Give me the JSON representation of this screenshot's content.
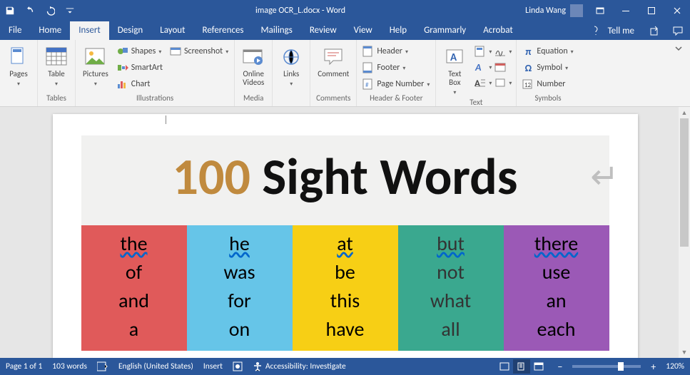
{
  "titlebar": {
    "title": "image OCR_L.docx - Word",
    "user": "Linda Wang"
  },
  "menu": {
    "items": [
      "File",
      "Home",
      "Insert",
      "Design",
      "Layout",
      "References",
      "Mailings",
      "Review",
      "View",
      "Help",
      "Grammarly",
      "Acrobat"
    ],
    "active": "Insert",
    "tellme": "Tell me"
  },
  "ribbon": {
    "pages": "Pages",
    "tables": {
      "btn": "Table",
      "label": "Tables"
    },
    "illustrations": {
      "pictures": "Pictures",
      "shapes": "Shapes",
      "smartart": "SmartArt",
      "chart": "Chart",
      "screenshot": "Screenshot",
      "label": "Illustrations"
    },
    "media": {
      "online": "Online\nVideos",
      "label": "Media"
    },
    "links": {
      "btn": "Links",
      "label": ""
    },
    "comments": {
      "btn": "Comment",
      "label": "Comments"
    },
    "headerfooter": {
      "header": "Header",
      "footer": "Footer",
      "pagenum": "Page Number",
      "label": "Header & Footer"
    },
    "text": {
      "textbox": "Text\nBox",
      "label": "Text"
    },
    "symbols": {
      "equation": "Equation",
      "symbol": "Symbol",
      "number": "Number",
      "label": "Symbols"
    }
  },
  "document": {
    "title_num": "100",
    "title_rest": " Sight Words",
    "columns": [
      {
        "class": "c1",
        "words": [
          "the",
          "of",
          "and",
          "a"
        ]
      },
      {
        "class": "c2",
        "words": [
          "he",
          "was",
          "for",
          "on"
        ]
      },
      {
        "class": "c3",
        "words": [
          "at",
          "be",
          "this",
          "have"
        ]
      },
      {
        "class": "c4",
        "words": [
          "but",
          "not",
          "what",
          "all"
        ]
      },
      {
        "class": "c5",
        "words": [
          "there",
          "use",
          "an",
          "each"
        ]
      }
    ]
  },
  "status": {
    "page": "Page 1 of 1",
    "words": "103 words",
    "lang": "English (United States)",
    "insert": "Insert",
    "access": "Accessibility: Investigate",
    "zoom": "120%"
  }
}
